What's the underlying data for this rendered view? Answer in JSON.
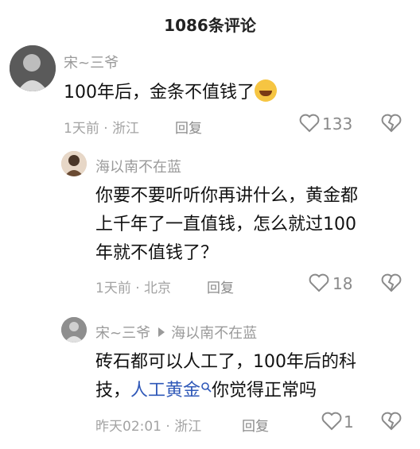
{
  "header": {
    "title": "1086条评论"
  },
  "comments": [
    {
      "user": "宋~三爷",
      "text": "100年后，金条不值钱了",
      "emoji": "laughing-crying-emoji",
      "meta": "1天前 · 浙江",
      "reply": "回复",
      "likes": "133"
    },
    {
      "user": "海以南不在蓝",
      "text_lines": [
        "你要不要听听你再讲什么，黄金都",
        "上千年了一直值钱，怎么就过100",
        "年就不值钱了？"
      ],
      "meta": "1天前 · 北京",
      "reply": "回复",
      "likes": "18"
    },
    {
      "user": "宋~三爷",
      "reply_to": "海以南不在蓝",
      "text_line1": "砖石都可以人工了，100年后的科",
      "text_line2_prefix": "技，",
      "text_line2_link": "人工黄金",
      "text_line2_suffix": "你觉得正常吗",
      "meta": "昨天02:01 · 浙江",
      "reply": "回复",
      "likes": "1"
    }
  ]
}
